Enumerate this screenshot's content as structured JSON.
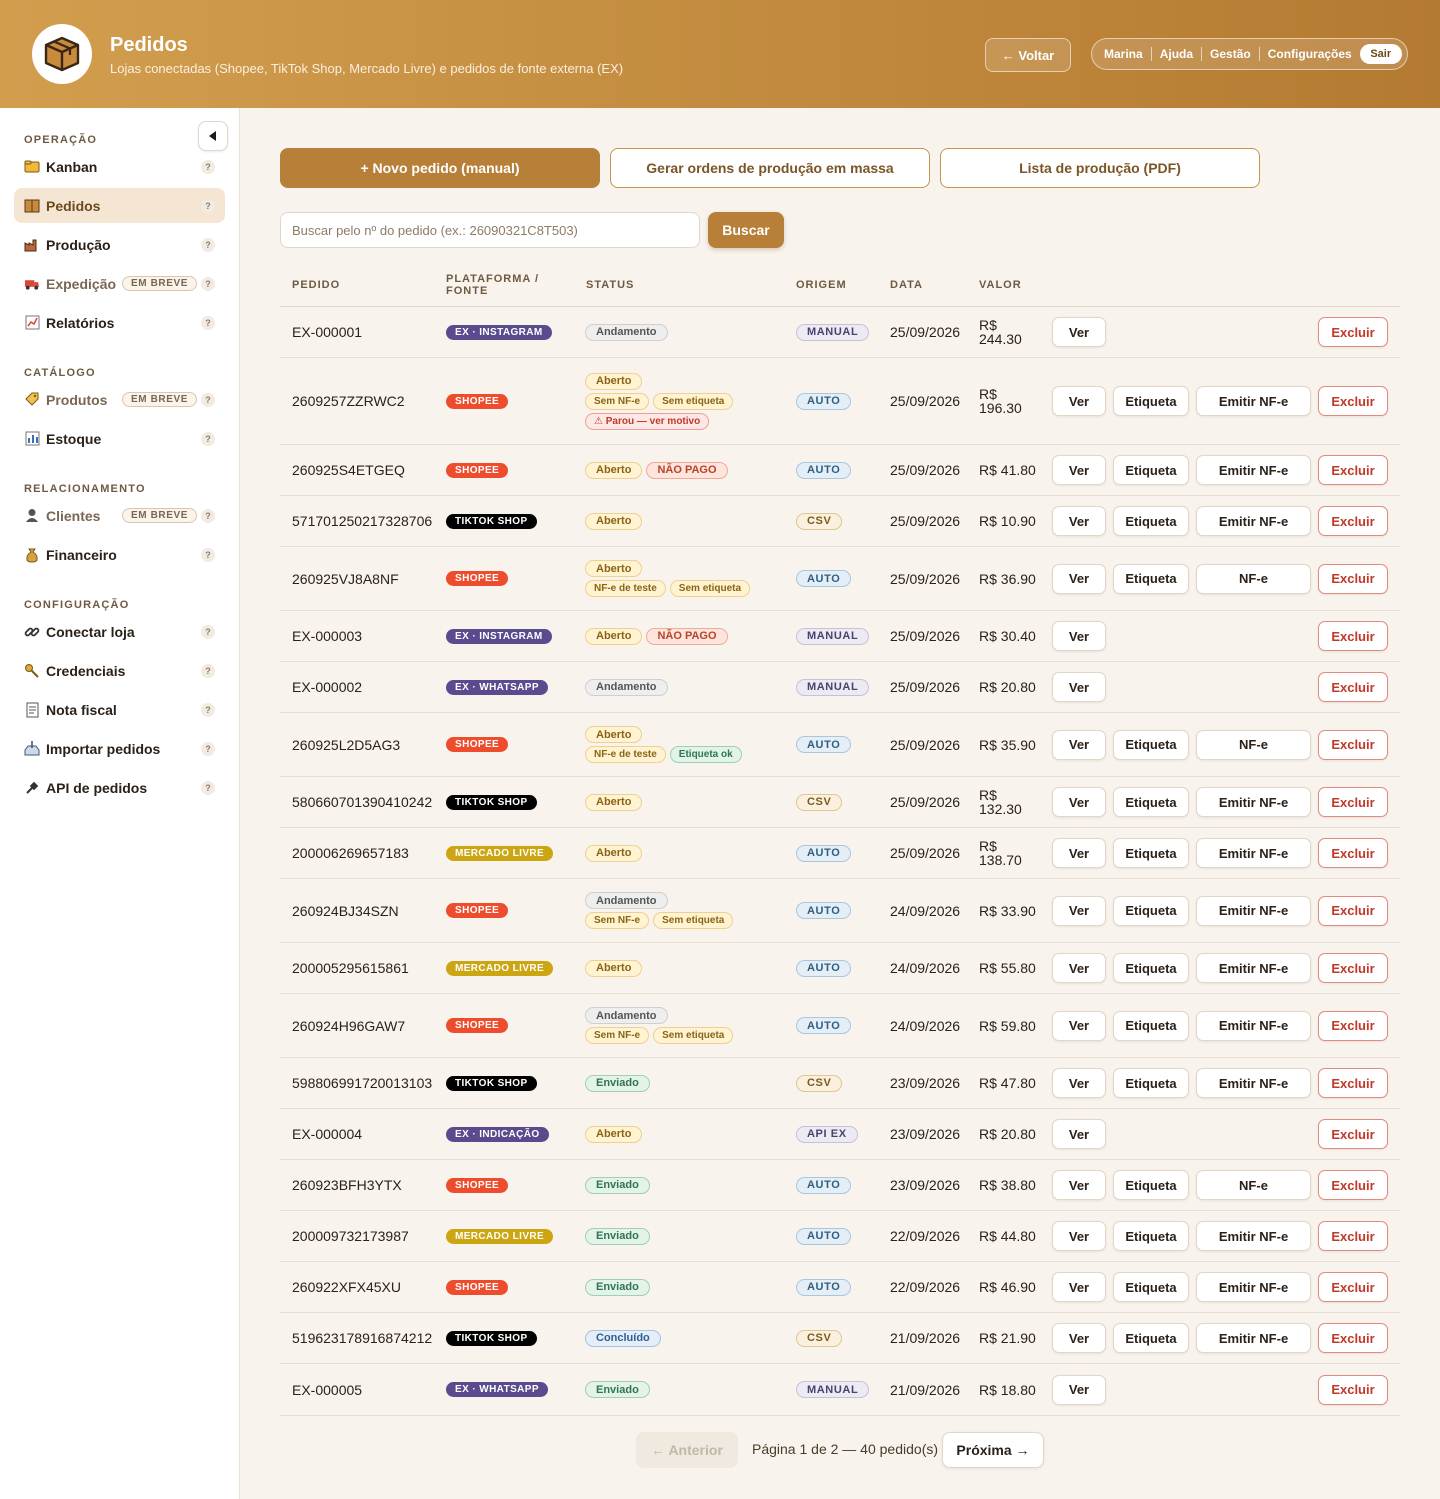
{
  "header": {
    "title": "Pedidos",
    "subtitle": "Lojas conectadas (Shopee, TikTok Shop, Mercado Livre) e pedidos de fonte externa (EX)",
    "back_label": "← Voltar",
    "user_name": "Marina",
    "links": [
      "Ajuda",
      "Gestão",
      "Configurações"
    ],
    "logout_label": "Sair"
  },
  "sidebar": {
    "sections": [
      {
        "title": "OPERAÇÃO",
        "items": [
          {
            "label": "Kanban",
            "icon": "folder-icon",
            "active": false,
            "soon": false
          },
          {
            "label": "Pedidos",
            "icon": "box-icon",
            "active": true,
            "soon": false
          },
          {
            "label": "Produção",
            "icon": "factory-icon",
            "active": false,
            "soon": false
          },
          {
            "label": "Expedição",
            "icon": "truck-icon",
            "active": false,
            "soon": true
          },
          {
            "label": "Relatórios",
            "icon": "chart-icon",
            "active": false,
            "soon": false
          }
        ]
      },
      {
        "title": "CATÁLOGO",
        "items": [
          {
            "label": "Produtos",
            "icon": "tag-icon",
            "active": false,
            "soon": true
          },
          {
            "label": "Estoque",
            "icon": "bar-chart-icon",
            "active": false,
            "soon": false
          }
        ]
      },
      {
        "title": "RELACIONAMENTO",
        "items": [
          {
            "label": "Clientes",
            "icon": "user-icon",
            "active": false,
            "soon": true
          },
          {
            "label": "Financeiro",
            "icon": "money-bag-icon",
            "active": false,
            "soon": false
          }
        ]
      },
      {
        "title": "CONFIGURAÇÃO",
        "items": [
          {
            "label": "Conectar loja",
            "icon": "link-icon",
            "active": false,
            "soon": false
          },
          {
            "label": "Credenciais",
            "icon": "key-icon",
            "active": false,
            "soon": false
          },
          {
            "label": "Nota fiscal",
            "icon": "receipt-icon",
            "active": false,
            "soon": false
          },
          {
            "label": "Importar pedidos",
            "icon": "inbox-icon",
            "active": false,
            "soon": false
          },
          {
            "label": "API de pedidos",
            "icon": "plug-icon",
            "active": false,
            "soon": false
          }
        ]
      }
    ],
    "soon_label": "EM BREVE",
    "help_label": "?"
  },
  "actions": {
    "new_order": "+ Novo pedido (manual)",
    "mass_production": "Gerar ordens de produção em massa",
    "production_list": "Lista de produção (PDF)"
  },
  "search": {
    "placeholder": "Buscar pelo nº do pedido (ex.: 26090321C8T503)",
    "button_label": "Buscar"
  },
  "table": {
    "columns": [
      "PEDIDO",
      "PLATAFORMA / FONTE",
      "STATUS",
      "ORIGEM",
      "DATA",
      "VALOR"
    ],
    "buttons": {
      "view": "Ver",
      "label": "Etiqueta",
      "delete": "Excluir"
    },
    "rows": [
      {
        "id": "EX-000001",
        "platform": "EX · INSTAGRAM",
        "ptype": "ex",
        "status": [
          [
            "Andamento:andamento"
          ]
        ],
        "origin": "MANUAL",
        "otype": "manual",
        "date": "25/09/2026",
        "value": "R$ 244.30",
        "etiqueta": false,
        "nfe": ""
      },
      {
        "id": "2609257ZZRWC2",
        "platform": "SHOPEE",
        "ptype": "shopee",
        "status": [
          [
            "Aberto:aberto"
          ],
          [
            "Sem NF-e:sem",
            "Sem etiqueta:sem"
          ],
          [
            "⚠ Parou — ver motivo:parou"
          ]
        ],
        "origin": "AUTO",
        "otype": "auto",
        "date": "25/09/2026",
        "value": "R$ 196.30",
        "etiqueta": true,
        "nfe": "Emitir NF-e"
      },
      {
        "id": "260925S4ETGEQ",
        "platform": "SHOPEE",
        "ptype": "shopee",
        "status": [
          [
            "Aberto:aberto",
            "NÃO PAGO:naopago"
          ]
        ],
        "origin": "AUTO",
        "otype": "auto",
        "date": "25/09/2026",
        "value": "R$ 41.80",
        "etiqueta": true,
        "nfe": "Emitir NF-e"
      },
      {
        "id": "571701250217328706",
        "platform": "TIKTOK SHOP",
        "ptype": "tiktok",
        "status": [
          [
            "Aberto:aberto"
          ]
        ],
        "origin": "CSV",
        "otype": "csv",
        "date": "25/09/2026",
        "value": "R$ 10.90",
        "etiqueta": true,
        "nfe": "Emitir NF-e"
      },
      {
        "id": "260925VJ8A8NF",
        "platform": "SHOPEE",
        "ptype": "shopee",
        "status": [
          [
            "Aberto:aberto"
          ],
          [
            "NF-e de teste:teste",
            "Sem etiqueta:sem"
          ]
        ],
        "origin": "AUTO",
        "otype": "auto",
        "date": "25/09/2026",
        "value": "R$ 36.90",
        "etiqueta": true,
        "nfe": "NF-e"
      },
      {
        "id": "EX-000003",
        "platform": "EX · INSTAGRAM",
        "ptype": "ex",
        "status": [
          [
            "Aberto:aberto",
            "NÃO PAGO:naopago"
          ]
        ],
        "origin": "MANUAL",
        "otype": "manual",
        "date": "25/09/2026",
        "value": "R$ 30.40",
        "etiqueta": false,
        "nfe": ""
      },
      {
        "id": "EX-000002",
        "platform": "EX · WHATSAPP",
        "ptype": "ex",
        "status": [
          [
            "Andamento:andamento"
          ]
        ],
        "origin": "MANUAL",
        "otype": "manual",
        "date": "25/09/2026",
        "value": "R$ 20.80",
        "etiqueta": false,
        "nfe": ""
      },
      {
        "id": "260925L2D5AG3",
        "platform": "SHOPEE",
        "ptype": "shopee",
        "status": [
          [
            "Aberto:aberto"
          ],
          [
            "NF-e de teste:teste",
            "Etiqueta ok:etiqok"
          ]
        ],
        "origin": "AUTO",
        "otype": "auto",
        "date": "25/09/2026",
        "value": "R$ 35.90",
        "etiqueta": true,
        "nfe": "NF-e"
      },
      {
        "id": "580660701390410242",
        "platform": "TIKTOK SHOP",
        "ptype": "tiktok",
        "status": [
          [
            "Aberto:aberto"
          ]
        ],
        "origin": "CSV",
        "otype": "csv",
        "date": "25/09/2026",
        "value": "R$ 132.30",
        "etiqueta": true,
        "nfe": "Emitir NF-e"
      },
      {
        "id": "200006269657183",
        "platform": "MERCADO LIVRE",
        "ptype": "ml",
        "status": [
          [
            "Aberto:aberto"
          ]
        ],
        "origin": "AUTO",
        "otype": "auto",
        "date": "25/09/2026",
        "value": "R$ 138.70",
        "etiqueta": true,
        "nfe": "Emitir NF-e"
      },
      {
        "id": "260924BJ34SZN",
        "platform": "SHOPEE",
        "ptype": "shopee",
        "status": [
          [
            "Andamento:andamento"
          ],
          [
            "Sem NF-e:sem",
            "Sem etiqueta:sem"
          ]
        ],
        "origin": "AUTO",
        "otype": "auto",
        "date": "24/09/2026",
        "value": "R$ 33.90",
        "etiqueta": true,
        "nfe": "Emitir NF-e"
      },
      {
        "id": "200005295615861",
        "platform": "MERCADO LIVRE",
        "ptype": "ml",
        "status": [
          [
            "Aberto:aberto"
          ]
        ],
        "origin": "AUTO",
        "otype": "auto",
        "date": "24/09/2026",
        "value": "R$ 55.80",
        "etiqueta": true,
        "nfe": "Emitir NF-e"
      },
      {
        "id": "260924H96GAW7",
        "platform": "SHOPEE",
        "ptype": "shopee",
        "status": [
          [
            "Andamento:andamento"
          ],
          [
            "Sem NF-e:sem",
            "Sem etiqueta:sem"
          ]
        ],
        "origin": "AUTO",
        "otype": "auto",
        "date": "24/09/2026",
        "value": "R$ 59.80",
        "etiqueta": true,
        "nfe": "Emitir NF-e"
      },
      {
        "id": "598806991720013103",
        "platform": "TIKTOK SHOP",
        "ptype": "tiktok",
        "status": [
          [
            "Enviado:enviado"
          ]
        ],
        "origin": "CSV",
        "otype": "csv",
        "date": "23/09/2026",
        "value": "R$ 47.80",
        "etiqueta": true,
        "nfe": "Emitir NF-e"
      },
      {
        "id": "EX-000004",
        "platform": "EX · INDICAÇÃO",
        "ptype": "ex",
        "status": [
          [
            "Aberto:aberto"
          ]
        ],
        "origin": "API EX",
        "otype": "api",
        "date": "23/09/2026",
        "value": "R$ 20.80",
        "etiqueta": false,
        "nfe": ""
      },
      {
        "id": "260923BFH3YTX",
        "platform": "SHOPEE",
        "ptype": "shopee",
        "status": [
          [
            "Enviado:enviado"
          ]
        ],
        "origin": "AUTO",
        "otype": "auto",
        "date": "23/09/2026",
        "value": "R$ 38.80",
        "etiqueta": true,
        "nfe": "NF-e"
      },
      {
        "id": "200009732173987",
        "platform": "MERCADO LIVRE",
        "ptype": "ml",
        "status": [
          [
            "Enviado:enviado"
          ]
        ],
        "origin": "AUTO",
        "otype": "auto",
        "date": "22/09/2026",
        "value": "R$ 44.80",
        "etiqueta": true,
        "nfe": "Emitir NF-e"
      },
      {
        "id": "260922XFX45XU",
        "platform": "SHOPEE",
        "ptype": "shopee",
        "status": [
          [
            "Enviado:enviado"
          ]
        ],
        "origin": "AUTO",
        "otype": "auto",
        "date": "22/09/2026",
        "value": "R$ 46.90",
        "etiqueta": true,
        "nfe": "Emitir NF-e"
      },
      {
        "id": "519623178916874212",
        "platform": "TIKTOK SHOP",
        "ptype": "tiktok",
        "status": [
          [
            "Concluído:concluido"
          ]
        ],
        "origin": "CSV",
        "otype": "csv",
        "date": "21/09/2026",
        "value": "R$ 21.90",
        "etiqueta": true,
        "nfe": "Emitir NF-e"
      },
      {
        "id": "EX-000005",
        "platform": "EX · WHATSAPP",
        "ptype": "ex",
        "status": [
          [
            "Enviado:enviado"
          ]
        ],
        "origin": "MANUAL",
        "otype": "manual",
        "date": "21/09/2026",
        "value": "R$ 18.80",
        "etiqueta": false,
        "nfe": ""
      }
    ]
  },
  "pagination": {
    "prev_label": "← Anterior",
    "info": "Página 1 de 2 — 40 pedido(s)",
    "next_label": "Próxima →"
  }
}
